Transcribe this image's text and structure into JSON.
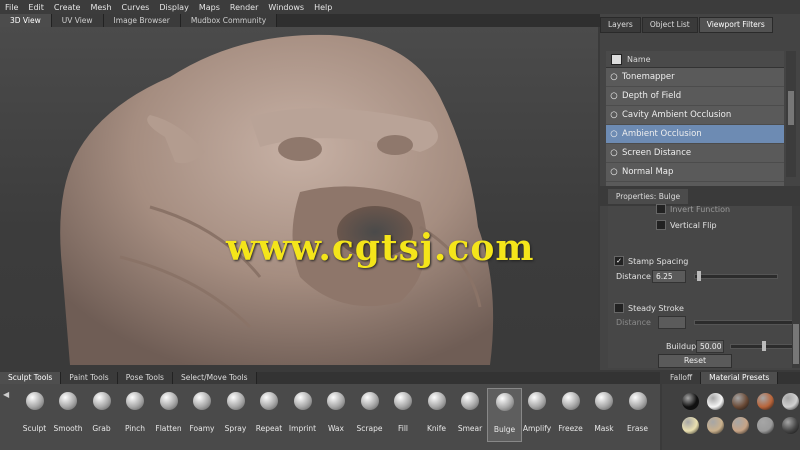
{
  "menu": [
    "File",
    "Edit",
    "Create",
    "Mesh",
    "Curves",
    "Display",
    "Maps",
    "Render",
    "Windows",
    "Help"
  ],
  "view_tabs": [
    {
      "label": "3D View",
      "active": true
    },
    {
      "label": "UV View",
      "active": false
    },
    {
      "label": "Image Browser",
      "active": false
    },
    {
      "label": "Mudbox Community",
      "active": false
    }
  ],
  "watermark": "www.cgtsj.com",
  "right_tabs": [
    {
      "label": "Layers",
      "active": false
    },
    {
      "label": "Object List",
      "active": false
    },
    {
      "label": "Viewport Filters",
      "active": true
    }
  ],
  "filter_list": {
    "header": "Name",
    "items": [
      {
        "label": "Tonemapper",
        "selected": false
      },
      {
        "label": "Depth of Field",
        "selected": false
      },
      {
        "label": "Cavity Ambient Occlusion",
        "selected": false
      },
      {
        "label": "Ambient Occlusion",
        "selected": true
      },
      {
        "label": "Screen Distance",
        "selected": false
      },
      {
        "label": "Normal Map",
        "selected": false
      }
    ]
  },
  "properties": {
    "tab": "Properties: Bulge",
    "invert_function": "Invert Function",
    "vertical_flip": "Vertical Flip",
    "stamp_spacing": "Stamp Spacing",
    "distance_label": "Distance",
    "distance_value": "6.25",
    "steady_stroke": "Steady Stroke",
    "steady_distance_label": "Distance",
    "buildup_label": "Buildup",
    "buildup_value": "50.00",
    "reset_button": "Reset"
  },
  "bottom_tabs": [
    {
      "label": "Sculpt Tools",
      "active": true
    },
    {
      "label": "Paint Tools",
      "active": false
    },
    {
      "label": "Pose Tools",
      "active": false
    },
    {
      "label": "Select/Move Tools",
      "active": false
    }
  ],
  "tools": [
    "Sculpt",
    "Smooth",
    "Grab",
    "Pinch",
    "Flatten",
    "Foamy",
    "Spray",
    "Repeat",
    "Imprint",
    "Wax",
    "Scrape",
    "Fill",
    "Knife",
    "Smear",
    "Bulge",
    "Amplify",
    "Freeze",
    "Mask",
    "Erase"
  ],
  "active_tool": "Bulge",
  "material_tabs": [
    "Falloff",
    "Material Presets"
  ],
  "materials": [
    "#101010",
    "#f4f4f4",
    "#6a4a36",
    "#b8643a",
    "#d0d0d0",
    "#eae0b0",
    "#c9b08c",
    "#c7a486",
    "#9a9a9a",
    "#444444"
  ]
}
